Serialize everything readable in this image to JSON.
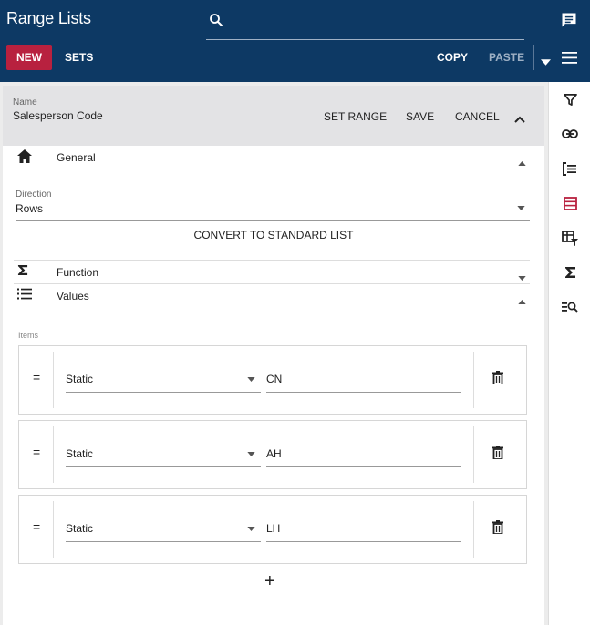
{
  "header": {
    "title": "Range Lists",
    "search_placeholder": "",
    "new_label": "NEW",
    "sets_label": "SETS",
    "copy_label": "COPY",
    "paste_label": "PASTE"
  },
  "name_bar": {
    "label": "Name",
    "value": "Salesperson Code",
    "set_range_label": "SET RANGE",
    "save_label": "SAVE",
    "cancel_label": "CANCEL"
  },
  "sections": {
    "general": "General",
    "function": "Function",
    "values": "Values"
  },
  "direction": {
    "label": "Direction",
    "value": "Rows"
  },
  "convert_label": "CONVERT TO STANDARD LIST",
  "items_label": "Items",
  "items": [
    {
      "operator": "=",
      "type": "Static",
      "value": "CN"
    },
    {
      "operator": "=",
      "type": "Static",
      "value": "AH"
    },
    {
      "operator": "=",
      "type": "Static",
      "value": "LH"
    }
  ],
  "add_label": "+",
  "sidebar_icons": [
    "filter-icon",
    "link-icon",
    "list-indent-icon",
    "table-icon",
    "table-filter-icon",
    "sigma-icon",
    "list-search-icon"
  ],
  "colors": {
    "header": "#0d3964",
    "accent": "#b8213f"
  }
}
